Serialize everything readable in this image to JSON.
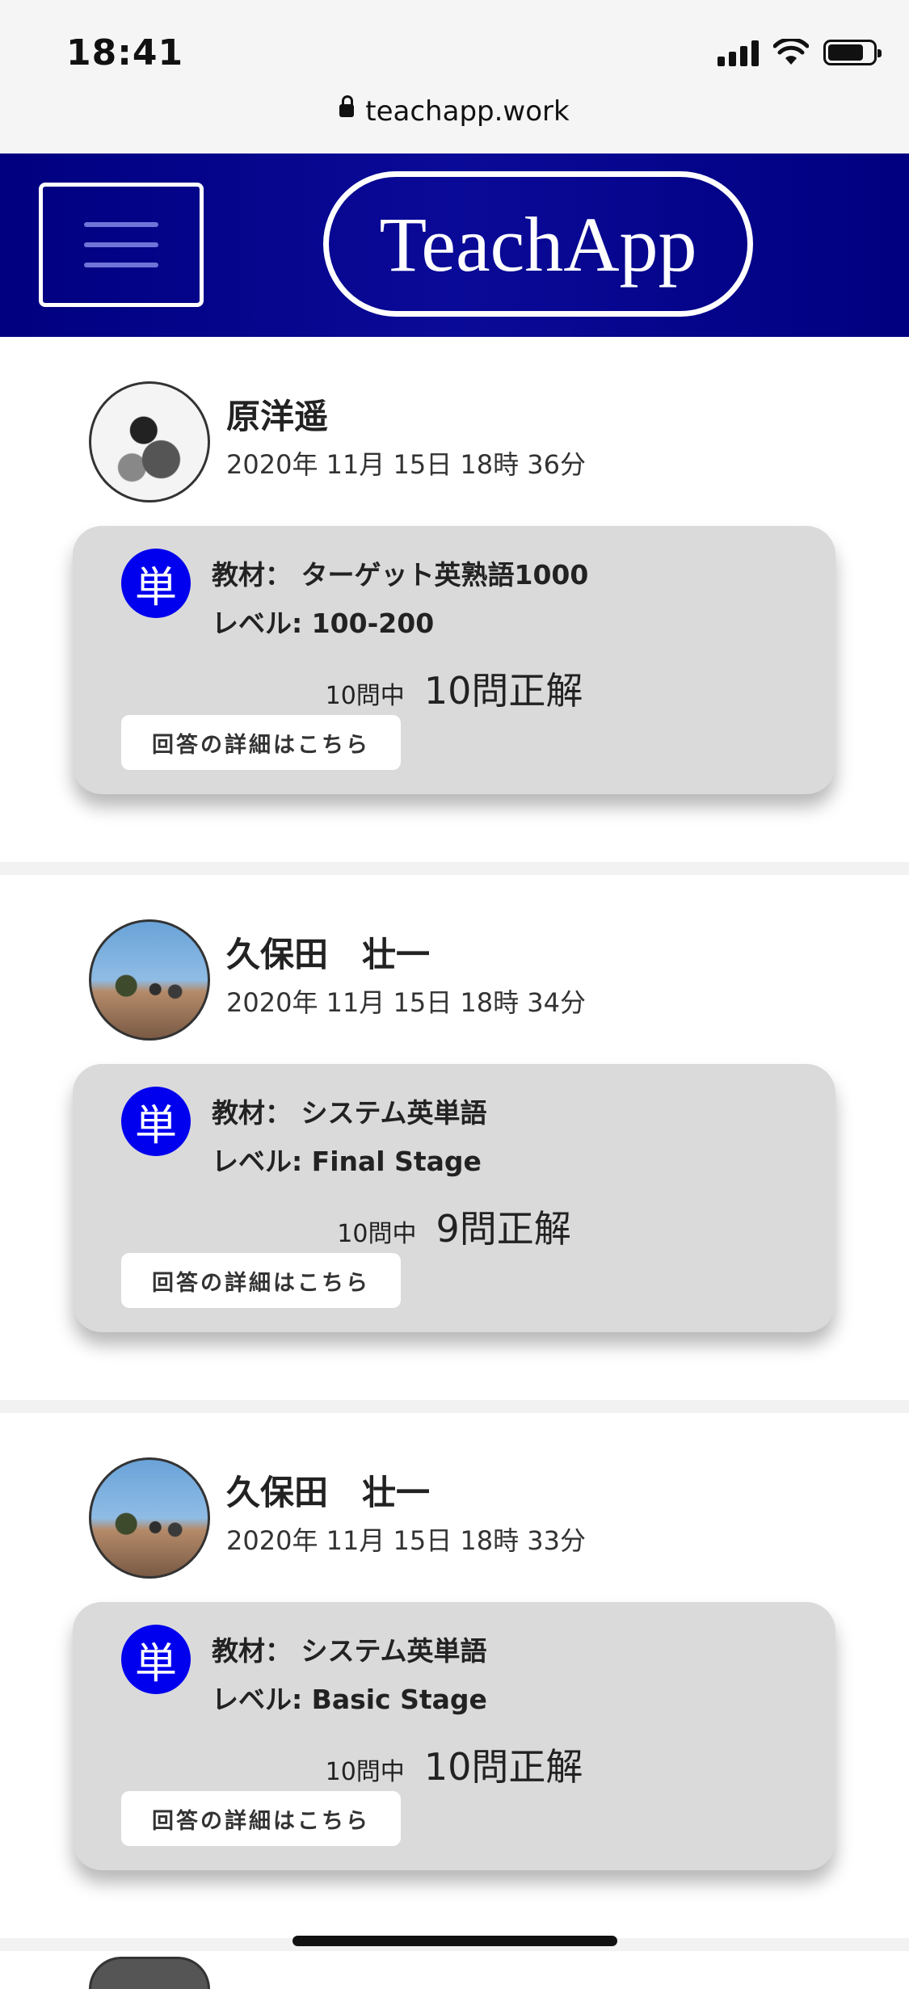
{
  "status_bar": {
    "time": "18:41",
    "url": "teachapp.work",
    "icons": [
      "signal-icon",
      "wifi-icon",
      "battery-icon",
      "lock-icon"
    ]
  },
  "header": {
    "brand": "TeachApp",
    "menu_icon": "hamburger-icon",
    "colors": {
      "header_bg": "#000080",
      "brand_border": "#ffffff",
      "menu_lines": "#6f75d8"
    }
  },
  "posts": [
    {
      "name": "原洋遥",
      "date": "2020年 11月 15日 18時 36分",
      "icon_label": "単",
      "material": "教材： ターゲット英熟語1000",
      "level": "レベル: 100-200",
      "questions": "10問中",
      "answer": "10問正解",
      "detail_button": "回答の詳細はこちら"
    },
    {
      "name": "久保田　壮一",
      "date": "2020年 11月 15日 18時 34分",
      "icon_label": "単",
      "material": "教材： システム英単語",
      "level": "レベル: Final Stage",
      "questions": "10問中",
      "answer": "9問正解",
      "detail_button": "回答の詳細はこちら"
    },
    {
      "name": "久保田　壮一",
      "date": "2020年 11月 15日 18時 33分",
      "icon_label": "単",
      "material": "教材： システム英単語",
      "level": "レベル: Basic Stage",
      "questions": "10問中",
      "answer": "10問正解",
      "detail_button": "回答の詳細はこちら"
    }
  ],
  "colors": {
    "card_bg": "#dadada",
    "tan_icon": "#0000ee"
  }
}
